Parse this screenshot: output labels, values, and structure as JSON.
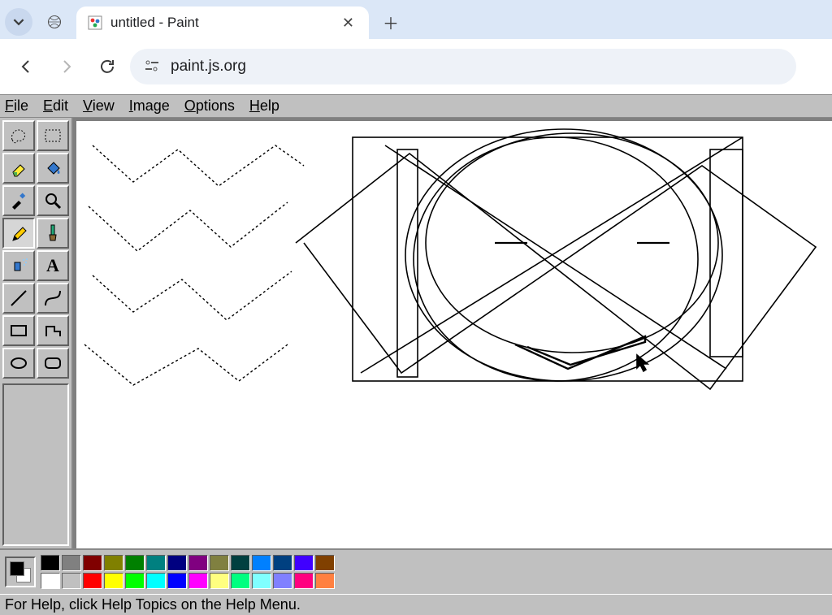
{
  "browser": {
    "tab_title": "untitled - Paint",
    "url": "paint.js.org"
  },
  "menus": [
    "File",
    "Edit",
    "View",
    "Image",
    "Options",
    "Help"
  ],
  "tools": [
    {
      "name": "free-form-select",
      "selected": false
    },
    {
      "name": "rect-select",
      "selected": false
    },
    {
      "name": "eraser",
      "selected": false
    },
    {
      "name": "fill",
      "selected": false
    },
    {
      "name": "eyedropper",
      "selected": false
    },
    {
      "name": "magnifier",
      "selected": false
    },
    {
      "name": "pencil",
      "selected": true
    },
    {
      "name": "brush",
      "selected": false
    },
    {
      "name": "airbrush",
      "selected": false
    },
    {
      "name": "text",
      "selected": false
    },
    {
      "name": "line",
      "selected": false
    },
    {
      "name": "curve",
      "selected": false
    },
    {
      "name": "rectangle",
      "selected": false
    },
    {
      "name": "polygon",
      "selected": false
    },
    {
      "name": "ellipse",
      "selected": false
    },
    {
      "name": "rounded-rect",
      "selected": false
    }
  ],
  "palette_row1": [
    "#000000",
    "#808080",
    "#800000",
    "#808000",
    "#008000",
    "#008080",
    "#000080",
    "#800080",
    "#808040",
    "#004040",
    "#0080ff",
    "#004080",
    "#4000ff",
    "#804000"
  ],
  "palette_row2": [
    "#ffffff",
    "#c0c0c0",
    "#ff0000",
    "#ffff00",
    "#00ff00",
    "#00ffff",
    "#0000ff",
    "#ff00ff",
    "#ffff80",
    "#00ff80",
    "#80ffff",
    "#8080ff",
    "#ff0080",
    "#ff8040"
  ],
  "current_fg": "#000000",
  "current_bg": "#ffffff",
  "status": "For Help, click Help Topics on the Help Menu."
}
